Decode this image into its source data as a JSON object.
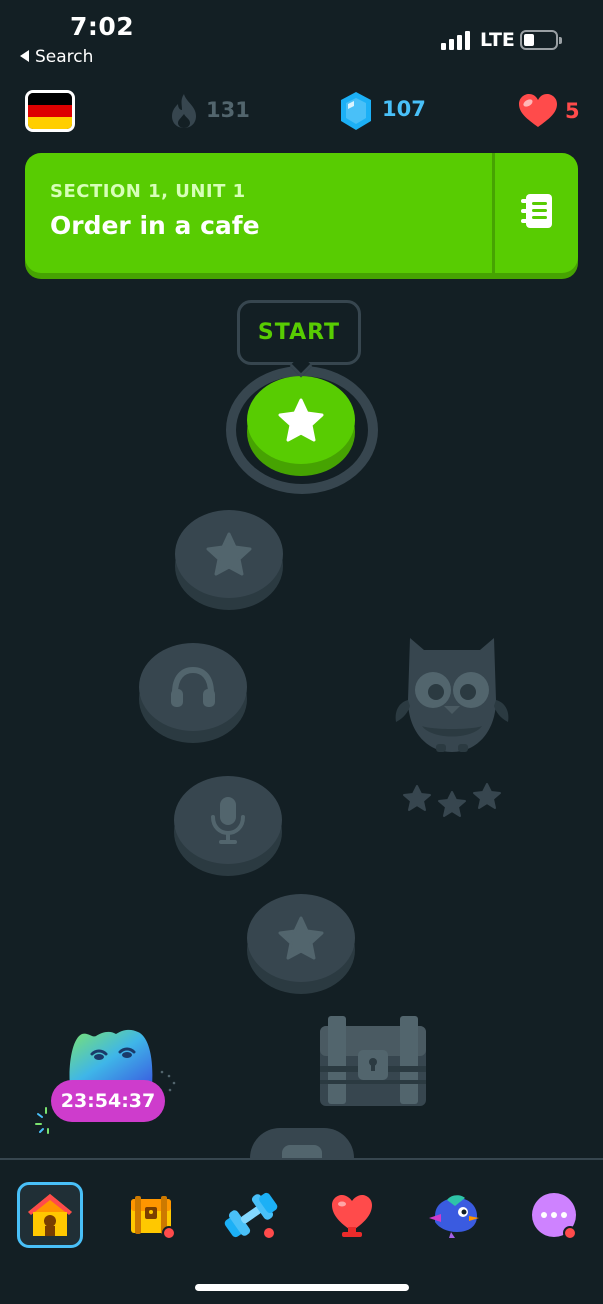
{
  "status_bar": {
    "time": "7:02",
    "back_label": "Search",
    "network": "LTE"
  },
  "top_bar": {
    "course_flag": "germany-flag",
    "streak": "131",
    "gems": "107",
    "hearts": "5"
  },
  "unit_banner": {
    "section": "SECTION 1, UNIT 1",
    "title": "Order in a cafe",
    "guide_icon": "guidebook-icon"
  },
  "path": {
    "start_label": "START",
    "nodes": [
      {
        "type": "star",
        "state": "active"
      },
      {
        "type": "star",
        "state": "locked"
      },
      {
        "type": "headphones",
        "state": "locked"
      },
      {
        "type": "microphone",
        "state": "locked"
      },
      {
        "type": "star",
        "state": "locked"
      },
      {
        "type": "chest",
        "state": "locked"
      }
    ],
    "character": "owl-character",
    "character_rating": "3-stars"
  },
  "timer": {
    "value": "23:54:37"
  },
  "bottom_nav": {
    "items": [
      {
        "name": "learn",
        "icon": "home-icon",
        "selected": true
      },
      {
        "name": "quests",
        "icon": "chest-icon",
        "notification": true
      },
      {
        "name": "practice",
        "icon": "dumbbell-icon",
        "notification": true
      },
      {
        "name": "leaderboards",
        "icon": "trophy-icon"
      },
      {
        "name": "shop",
        "icon": "bird-icon"
      },
      {
        "name": "more",
        "icon": "more-icon",
        "notification": true
      }
    ]
  },
  "colors": {
    "background": "#131f24",
    "green": "#58cc02",
    "locked": "#37464f",
    "gem_blue": "#49c0f8",
    "heart_red": "#ff4b4b",
    "timer_purple": "#ce3ccc"
  }
}
